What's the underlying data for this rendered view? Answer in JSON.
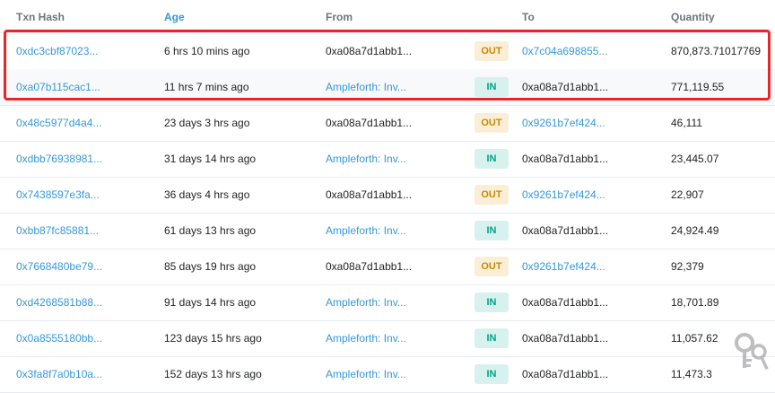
{
  "columns": {
    "hash": "Txn Hash",
    "age": "Age",
    "from": "From",
    "to": "To",
    "quantity": "Quantity"
  },
  "rows": [
    {
      "hash": "0xdc3cbf87023...",
      "age": "6 hrs 10 mins ago",
      "from": "0xa08a7d1abb1...",
      "dir": "OUT",
      "to": "0x7c04a698855...",
      "quantity": "870,873.71017769"
    },
    {
      "hash": "0xa07b115cac1...",
      "age": "11 hrs 7 mins ago",
      "from": "Ampleforth: Inv...",
      "dir": "IN",
      "to": "0xa08a7d1abb1...",
      "quantity": "771,119.55"
    },
    {
      "hash": "0x48c5977d4a4...",
      "age": "23 days 3 hrs ago",
      "from": "0xa08a7d1abb1...",
      "dir": "OUT",
      "to": "0x9261b7ef424...",
      "quantity": "46,111"
    },
    {
      "hash": "0xdbb76938981...",
      "age": "31 days 14 hrs ago",
      "from": "Ampleforth: Inv...",
      "dir": "IN",
      "to": "0xa08a7d1abb1...",
      "quantity": "23,445.07"
    },
    {
      "hash": "0x7438597e3fa...",
      "age": "36 days 4 hrs ago",
      "from": "0xa08a7d1abb1...",
      "dir": "OUT",
      "to": "0x9261b7ef424...",
      "quantity": "22,907"
    },
    {
      "hash": "0xbb87fc85881...",
      "age": "61 days 13 hrs ago",
      "from": "Ampleforth: Inv...",
      "dir": "IN",
      "to": "0xa08a7d1abb1...",
      "quantity": "24,924.49"
    },
    {
      "hash": "0x7668480be79...",
      "age": "85 days 19 hrs ago",
      "from": "0xa08a7d1abb1...",
      "dir": "OUT",
      "to": "0x9261b7ef424...",
      "quantity": "92,379"
    },
    {
      "hash": "0xd4268581b88...",
      "age": "91 days 14 hrs ago",
      "from": "Ampleforth: Inv...",
      "dir": "IN",
      "to": "0xa08a7d1abb1...",
      "quantity": "18,701.89"
    },
    {
      "hash": "0x0a8555180bb...",
      "age": "123 days 15 hrs ago",
      "from": "Ampleforth: Inv...",
      "dir": "IN",
      "to": "0xa08a7d1abb1...",
      "quantity": "11,057.62"
    },
    {
      "hash": "0x3fa8f7a0b10a...",
      "age": "152 days 13 hrs ago",
      "from": "Ampleforth: Inv...",
      "dir": "IN",
      "to": "0xa08a7d1abb1...",
      "quantity": "11,473.3"
    }
  ],
  "colors": {
    "link": "#3498db",
    "out_bg": "#fbeed7",
    "out_fg": "#c48a06",
    "in_bg": "#d7f2ee",
    "in_fg": "#00a186",
    "highlight": "#e8262a"
  },
  "icons": {
    "watermark": "keys-icon"
  }
}
